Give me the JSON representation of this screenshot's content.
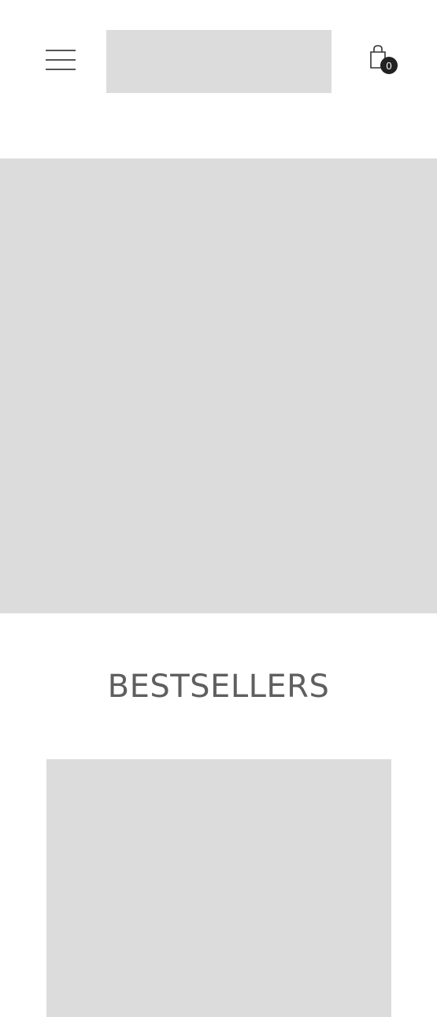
{
  "header": {
    "menu_icon": "hamburger-menu-icon",
    "logo_icon": "logo-placeholder",
    "cart": {
      "icon": "shopping-bag-icon",
      "count": "0"
    }
  },
  "hero": {
    "image": "hero-image-placeholder"
  },
  "bestsellers": {
    "title": "BESTSELLERS",
    "products": [
      {
        "image": "product-image-placeholder"
      }
    ]
  },
  "colors": {
    "placeholder": "#dcdcdc",
    "text": "#5f5f5f",
    "badge": "#222222"
  }
}
